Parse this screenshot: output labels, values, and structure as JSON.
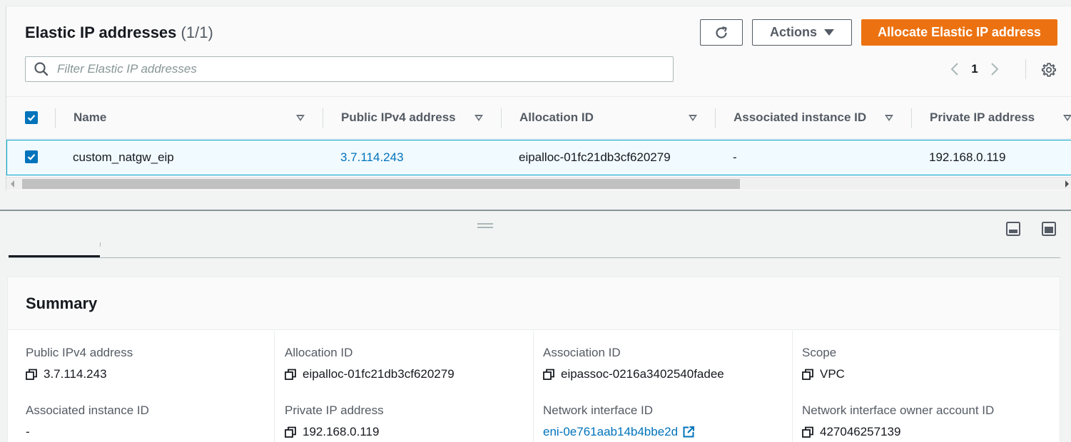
{
  "header": {
    "title": "Elastic IP addresses",
    "count": "(1/1)",
    "refresh_icon": "refresh-icon",
    "actions_label": "Actions",
    "allocate_label": "Allocate Elastic IP address"
  },
  "search": {
    "placeholder": "Filter Elastic IP addresses",
    "value": ""
  },
  "pagination": {
    "page": "1"
  },
  "table": {
    "columns": [
      "Name",
      "Public IPv4 address",
      "Allocation ID",
      "Associated instance ID",
      "Private IP address"
    ],
    "rows": [
      {
        "selected": true,
        "name": "custom_natgw_eip",
        "public_ip": "3.7.114.243",
        "allocation_id": "eipalloc-01fc21db3cf620279",
        "instance_id": "-",
        "private_ip": "192.168.0.119"
      }
    ]
  },
  "summary": {
    "title": "Summary",
    "fields": [
      {
        "label": "Public IPv4 address",
        "value": "3.7.114.243"
      },
      {
        "label": "Allocation ID",
        "value": "eipalloc-01fc21db3cf620279"
      },
      {
        "label": "Association ID",
        "value": "eipassoc-0216a3402540fadee"
      },
      {
        "label": "Scope",
        "value": "VPC"
      },
      {
        "label": "Associated instance ID",
        "value": "-"
      },
      {
        "label": "Private IP address",
        "value": "192.168.0.119"
      },
      {
        "label": "Network interface ID",
        "value": "eni-0e761aab14b4bbe2d"
      },
      {
        "label": "Network interface owner account ID",
        "value": "427046257139"
      }
    ]
  },
  "colors": {
    "primary": "#ec7211",
    "link": "#0073bb",
    "selected_row_bg": "#f1faff",
    "selected_row_border": "#00a1c9"
  }
}
